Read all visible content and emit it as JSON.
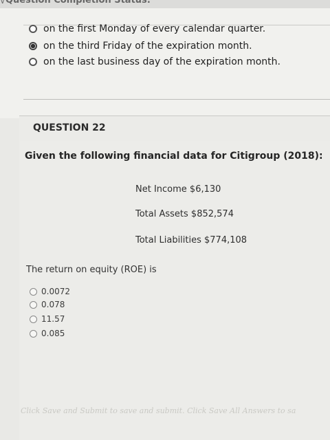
{
  "header": {
    "title": "Question Completion Status:"
  },
  "previous_question": {
    "options": [
      {
        "label": "on the first Monday of every calendar quarter.",
        "selected": false
      },
      {
        "label": "on the third Friday of the expiration month.",
        "selected": true
      },
      {
        "label": "on the last business day of the expiration month.",
        "selected": false
      }
    ]
  },
  "question": {
    "number_label": "QUESTION 22",
    "prompt": "Given the following financial data for Citigroup (2018):",
    "data": {
      "net_income": "Net Income $6,130",
      "total_assets": "Total Assets $852,574",
      "total_liabilities": "Total Liabilities $774,108"
    },
    "ask": "The return on equity (ROE) is",
    "answers": [
      "0.0072",
      "0.078",
      "11.57",
      "0.085"
    ]
  },
  "footer": {
    "hint": "Click Save and Submit to save and submit. Click Save All Answers to sa"
  }
}
